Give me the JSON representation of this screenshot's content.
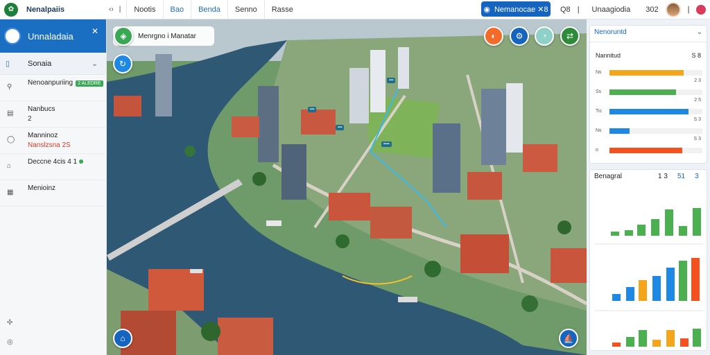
{
  "topbar": {
    "app_title": "Nenalpaiis",
    "nav_icon": "‹›",
    "tabs": [
      "Nootis",
      "Bao",
      "Benda",
      "Senno",
      "Rasse"
    ],
    "cta_label": "Nemanocae ✕8",
    "search_label": "Q8",
    "user_name": "Unaagiodia",
    "count": "302"
  },
  "sidebar": {
    "title": "Unnaladaia",
    "section": "Sonaia",
    "items": [
      {
        "line1": "Nenoanpuriing",
        "tag": "2 ALEDRE"
      },
      {
        "line1": "Nanbucs",
        "line2": "2"
      },
      {
        "line1": "Manninoz",
        "line2": "Nanslzsna 2S"
      },
      {
        "line1": "Deccne 4cis 4 1"
      },
      {
        "line1": "Menioinz"
      }
    ]
  },
  "map": {
    "chip": "Menrgno i Manatar"
  },
  "panel1": {
    "title": "Nenoruntd",
    "header_left": "Nannitud",
    "header_right": "S 8",
    "rows": [
      {
        "label": "Ns",
        "value": "2 3",
        "fill": 0.8,
        "color": "#f4a51c"
      },
      {
        "label": "Ss",
        "value": "2 5",
        "fill": 0.72,
        "color": "#4caf50"
      },
      {
        "label": "Tic",
        "value": "S 3",
        "fill": 0.85,
        "color": "#1e88e5"
      },
      {
        "label": "Ns",
        "value": "S 3",
        "fill": 0.22,
        "color": "#1e88e5"
      },
      {
        "label": "o",
        "value": "S 3",
        "fill": 0.78,
        "color": "#f4511e"
      }
    ]
  },
  "panel2": {
    "title": "Benagral",
    "values": [
      "1 3",
      "51",
      "3"
    ]
  },
  "colors": {
    "primary": "#1b6fc2",
    "orange": "#f4a51c",
    "green": "#4caf50",
    "blue": "#1e88e5",
    "red": "#f4511e"
  }
}
